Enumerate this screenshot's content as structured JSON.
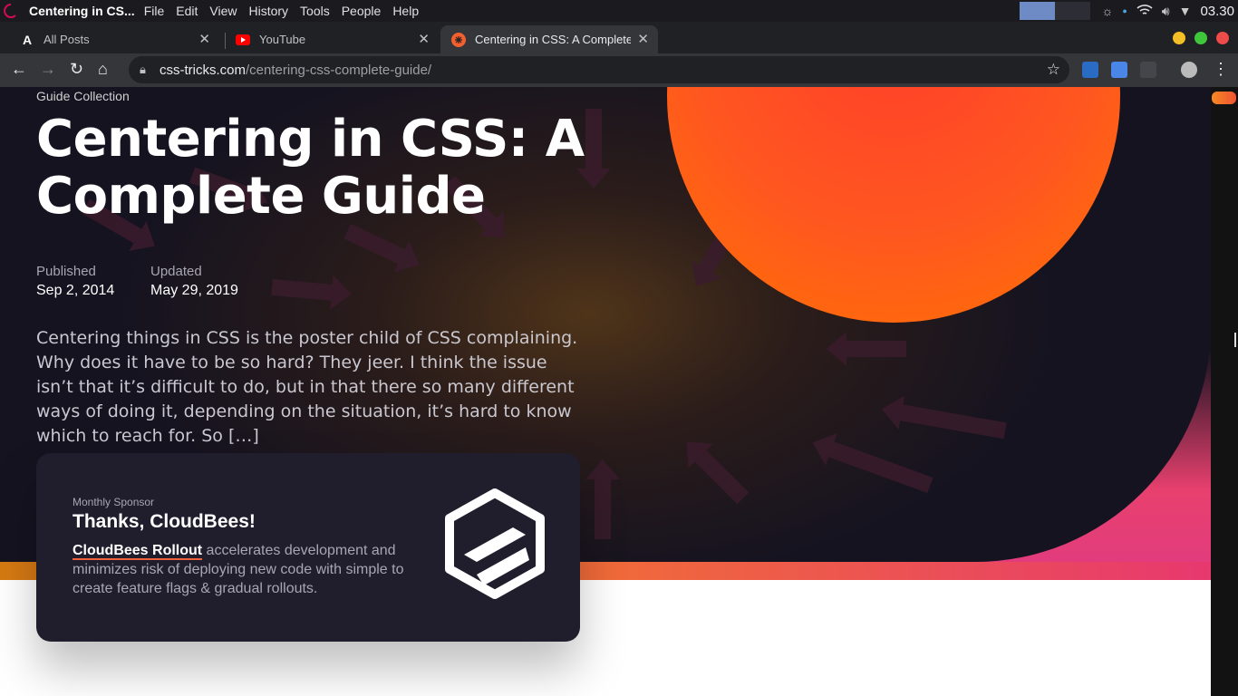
{
  "os": {
    "app_title": "Centering in CS...",
    "menu": [
      "File",
      "Edit",
      "View",
      "History",
      "Tools",
      "People",
      "Help"
    ],
    "clock": "03.30"
  },
  "tabs": [
    {
      "label": "All Posts",
      "icon": "a-icon"
    },
    {
      "label": "YouTube",
      "icon": "youtube-icon"
    },
    {
      "label": "Centering in CSS: A Complete Guide",
      "icon": "css-tricks-icon",
      "active": true
    }
  ],
  "toolbar": {
    "url_host": "css-tricks.com",
    "url_path": "/centering-css-complete-guide/"
  },
  "article": {
    "crumb": "Guide Collection",
    "title": "Centering in CSS: A Complete Guide",
    "published_label": "Published",
    "published_value": "Sep 2, 2014",
    "updated_label": "Updated",
    "updated_value": "May 29, 2019",
    "excerpt": "Centering things in CSS is the poster child of CSS complaining. Why does it have to be so hard? They jeer. I think the issue isn’t that it’s difficult to do, but in that there so many different ways of doing it, depending on the situation, it’s hard to know which to reach for. So […]"
  },
  "sponsor": {
    "kicker": "Monthly Sponsor",
    "title": "Thanks, CloudBees!",
    "link": "CloudBees Rollout",
    "body": " accelerates development and minimizes risk of deploying new code with simple to create feature flags & gradual rollouts."
  },
  "colors": {
    "sun": "#ff5a1f",
    "accent_gradient_start": "#d57a12",
    "accent_gradient_end": "#e7386f",
    "card_bg": "#201e2d"
  }
}
